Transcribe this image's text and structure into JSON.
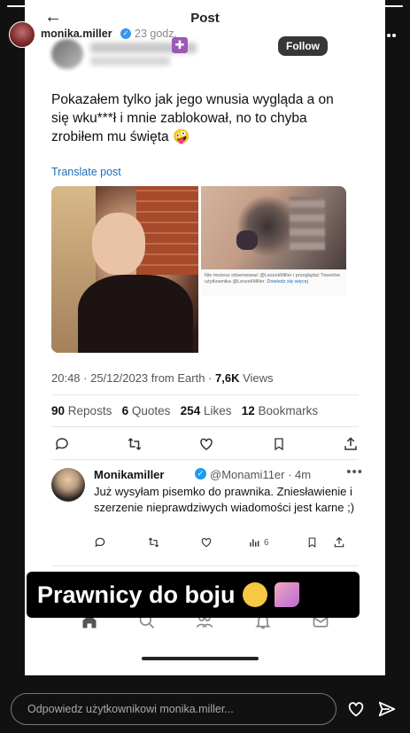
{
  "story": {
    "username": "monika.miller",
    "time": "23 godz.",
    "follow_label": "Follow",
    "caption": "Prawnicy do boju",
    "reply_placeholder": "Odpowiedz użytkownikowi monika.miller...",
    "progress": 1.0
  },
  "post_screen": {
    "title": "Post",
    "tweet_text": "Pokazałem tylko jak jego wnusia wygląda a on się wku***ł i mnie zablokował, no to chyba zrobiłem mu święta 🤪",
    "translate_label": "Translate post",
    "image_note": "Nie możesz obserwować @LeszekMiller i przeglądać Tweetów użytkownika @LeszekMiller.",
    "image_note_link": "Dowiedz się więcej",
    "time": "20:48 · 25/12/2023 from Earth · ",
    "views_count": "7,6K",
    "views_label": " Views",
    "stats": [
      {
        "value": "90",
        "label": "Reposts"
      },
      {
        "value": "6",
        "label": "Quotes"
      },
      {
        "value": "254",
        "label": "Likes"
      },
      {
        "value": "12",
        "label": "Bookmarks"
      }
    ],
    "reply": {
      "name": "Monikamiller",
      "handle": "@Monami11er · 4m",
      "text": "Już wysyłam pisemko do prawnika. Zniesławienie i szerzenie nieprawdziwych wiadomości jest karne ;)",
      "views": "6"
    }
  },
  "colors": {
    "link": "#1d6fb8",
    "verified": "#1d9bf0",
    "caption_bg": "#000000"
  }
}
